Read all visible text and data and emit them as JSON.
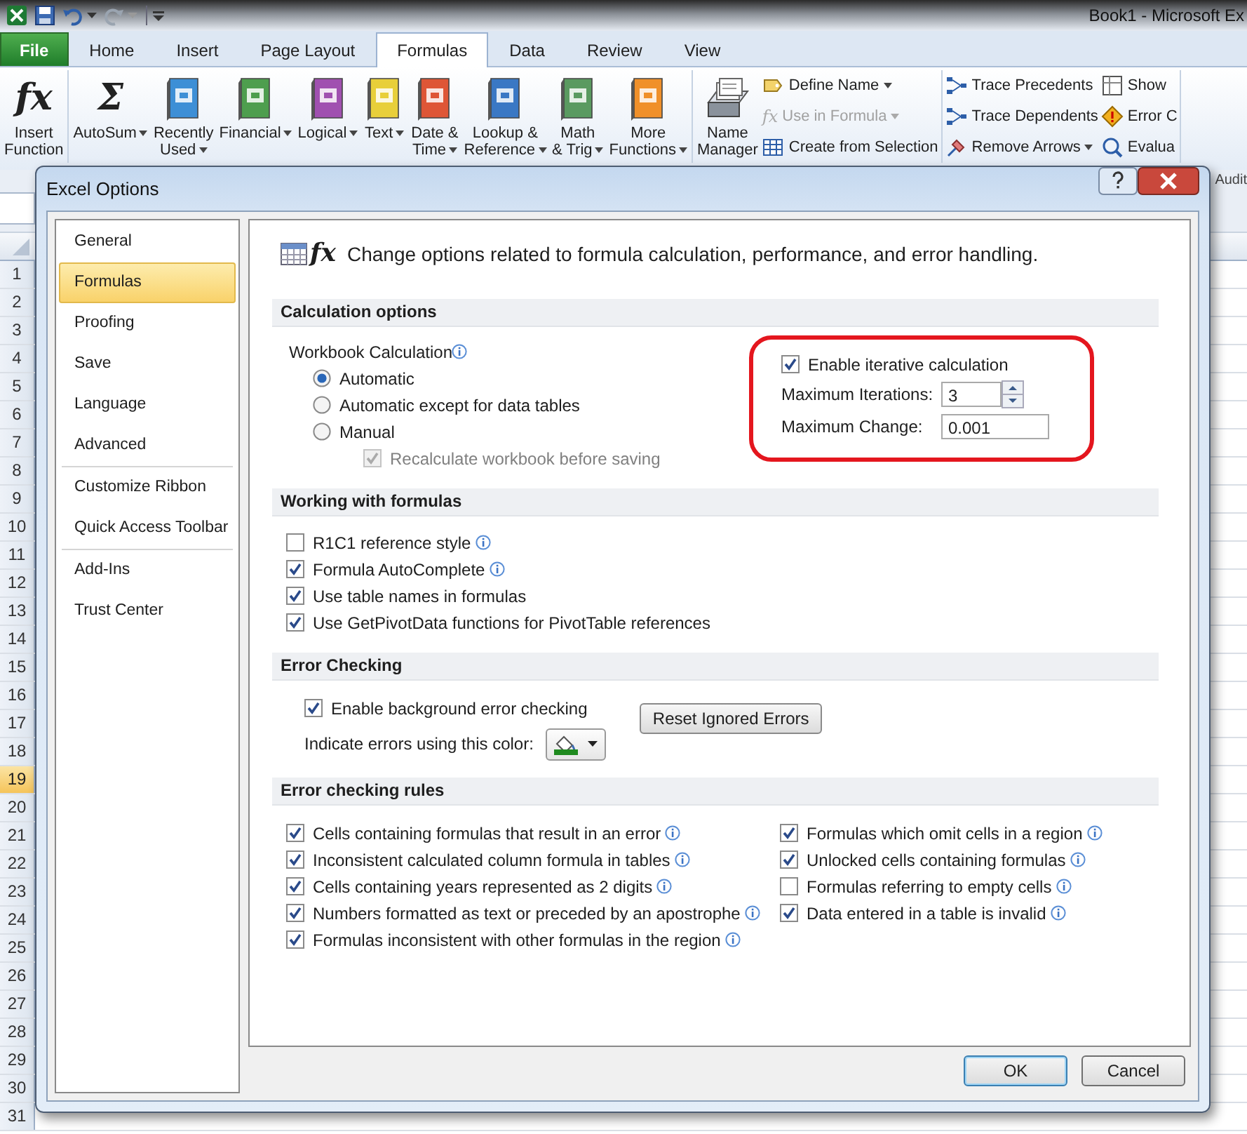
{
  "titlebar": {
    "title": "Book1 - Microsoft Ex"
  },
  "ribbon_tabs": [
    {
      "label": "File",
      "kind": "file",
      "selected": false
    },
    {
      "label": "Home",
      "kind": "tab",
      "selected": false
    },
    {
      "label": "Insert",
      "kind": "tab",
      "selected": false
    },
    {
      "label": "Page Layout",
      "kind": "tab",
      "selected": false
    },
    {
      "label": "Formulas",
      "kind": "tab",
      "selected": true
    },
    {
      "label": "Data",
      "kind": "tab",
      "selected": false
    },
    {
      "label": "Review",
      "kind": "tab",
      "selected": false
    },
    {
      "label": "View",
      "kind": "tab",
      "selected": false
    }
  ],
  "ribbon_groups": [
    {
      "large": [
        {
          "lines": [
            "Insert",
            "Function"
          ],
          "kind": "glyph",
          "glyph": "fx",
          "dropdown": false
        }
      ]
    },
    {
      "large": [
        {
          "lines": [
            "AutoSum"
          ],
          "kind": "glyph",
          "glyph": "Σ",
          "dropdown": true
        },
        {
          "lines": [
            "Recently",
            "Used"
          ],
          "kind": "book",
          "color": "#3d8fd6",
          "dropdown": true
        },
        {
          "lines": [
            "Financial"
          ],
          "kind": "book",
          "color": "#4e9e4e",
          "dropdown": true
        },
        {
          "lines": [
            "Logical"
          ],
          "kind": "book",
          "color": "#a050b0",
          "dropdown": true
        },
        {
          "lines": [
            "Text"
          ],
          "kind": "book",
          "color": "#e8cf3a",
          "dropdown": true
        },
        {
          "lines": [
            "Date &",
            "Time"
          ],
          "kind": "book",
          "color": "#de5636",
          "dropdown": true
        },
        {
          "lines": [
            "Lookup &",
            "Reference"
          ],
          "kind": "book",
          "color": "#3a78c4",
          "dropdown": true
        },
        {
          "lines": [
            "Math",
            "& Trig"
          ],
          "kind": "book",
          "color": "#5a9a60",
          "dropdown": true
        },
        {
          "lines": [
            "More",
            "Functions"
          ],
          "kind": "book",
          "color": "#f0902a",
          "dropdown": true
        }
      ]
    },
    {
      "large": [
        {
          "lines": [
            "Name",
            "Manager"
          ],
          "kind": "cards",
          "dropdown": false
        }
      ],
      "small_columns": [
        [
          {
            "label": "Define Name",
            "kind": "tag",
            "dropdown": true,
            "disabled": false
          },
          {
            "label": "Use in Formula",
            "kind": "glyph",
            "glyph": "fx",
            "dropdown": true,
            "disabled": true
          },
          {
            "label": "Create from Selection",
            "kind": "table",
            "dropdown": false,
            "disabled": false
          }
        ]
      ]
    },
    {
      "small_columns": [
        [
          {
            "label": "Trace Precedents",
            "kind": "trace",
            "dropdown": false,
            "disabled": false
          },
          {
            "label": "Trace Dependents",
            "kind": "trace",
            "dropdown": false,
            "disabled": false
          },
          {
            "label": "Remove Arrows",
            "kind": "eraser",
            "dropdown": true,
            "disabled": false
          }
        ],
        [
          {
            "label": "Show",
            "kind": "sheet",
            "dropdown": false,
            "disabled": false
          },
          {
            "label": "Error C",
            "kind": "warning",
            "dropdown": false,
            "disabled": false
          },
          {
            "label": "Evalua",
            "kind": "evaluate",
            "dropdown": false,
            "disabled": false
          }
        ]
      ]
    }
  ],
  "group_label": "Audit",
  "sheet": {
    "rows": [
      {
        "label": "1",
        "selected": false
      },
      {
        "label": "2",
        "selected": false
      },
      {
        "label": "3",
        "selected": false
      },
      {
        "label": "4",
        "selected": false
      },
      {
        "label": "5",
        "selected": false
      },
      {
        "label": "6",
        "selected": false
      },
      {
        "label": "7",
        "selected": false
      },
      {
        "label": "8",
        "selected": false
      },
      {
        "label": "9",
        "selected": false
      },
      {
        "label": "10",
        "selected": false
      },
      {
        "label": "11",
        "selected": false
      },
      {
        "label": "12",
        "selected": false
      },
      {
        "label": "13",
        "selected": false
      },
      {
        "label": "14",
        "selected": false
      },
      {
        "label": "15",
        "selected": false
      },
      {
        "label": "16",
        "selected": false
      },
      {
        "label": "17",
        "selected": false
      },
      {
        "label": "18",
        "selected": false
      },
      {
        "label": "19",
        "selected": true
      },
      {
        "label": "20",
        "selected": false
      },
      {
        "label": "21",
        "selected": false
      },
      {
        "label": "22",
        "selected": false
      },
      {
        "label": "23",
        "selected": false
      },
      {
        "label": "24",
        "selected": false
      },
      {
        "label": "25",
        "selected": false
      },
      {
        "label": "26",
        "selected": false
      },
      {
        "label": "27",
        "selected": false
      },
      {
        "label": "28",
        "selected": false
      },
      {
        "label": "29",
        "selected": false
      },
      {
        "label": "30",
        "selected": false
      },
      {
        "label": "31",
        "selected": false
      }
    ]
  },
  "dialog": {
    "title": "Excel Options",
    "nav_groups": [
      [
        {
          "label": "General",
          "selected": false
        },
        {
          "label": "Formulas",
          "selected": true
        },
        {
          "label": "Proofing",
          "selected": false
        },
        {
          "label": "Save",
          "selected": false
        },
        {
          "label": "Language",
          "selected": false
        },
        {
          "label": "Advanced",
          "selected": false
        }
      ],
      [
        {
          "label": "Customize Ribbon",
          "selected": false
        },
        {
          "label": "Quick Access Toolbar",
          "selected": false
        }
      ],
      [
        {
          "label": "Add-Ins",
          "selected": false
        },
        {
          "label": "Trust Center",
          "selected": false
        }
      ]
    ],
    "header": {
      "glyph": "fx",
      "text": "Change options related to formula calculation, performance, and error handling."
    },
    "calculation": {
      "title": "Calculation options",
      "workbook_label": "Workbook Calculation",
      "workbook_info": true,
      "modes": [
        {
          "label": "Automatic",
          "selected": true
        },
        {
          "label": "Automatic except for data tables",
          "selected": false
        },
        {
          "label": "Manual",
          "selected": false
        }
      ],
      "recalc": {
        "label": "Recalculate workbook before saving",
        "checked": true,
        "disabled": true
      },
      "iterative": {
        "label": "Enable iterative calculation",
        "checked": true
      },
      "max_iterations": {
        "label": "Maximum Iterations:",
        "value": "3"
      },
      "max_change": {
        "label": "Maximum Change:",
        "value": "0.001"
      }
    },
    "formulas": {
      "title": "Working with formulas",
      "options": [
        {
          "label": "R1C1 reference style",
          "checked": false,
          "info": true
        },
        {
          "label": "Formula AutoComplete",
          "checked": true,
          "info": true
        },
        {
          "label": "Use table names in formulas",
          "checked": true,
          "info": false
        },
        {
          "label": "Use GetPivotData functions for PivotTable references",
          "checked": true,
          "info": false
        }
      ]
    },
    "error_checking": {
      "title": "Error Checking",
      "background": {
        "label": "Enable background error checking",
        "checked": true
      },
      "color_label": "Indicate errors using this color:",
      "color": "#1f8a1f",
      "reset_button": "Reset Ignored Errors"
    },
    "rules": {
      "title": "Error checking rules",
      "columns": [
        [
          {
            "label": "Cells containing formulas that result in an error",
            "checked": true,
            "info": true
          },
          {
            "label": "Inconsistent calculated column formula in tables",
            "checked": true,
            "info": true
          },
          {
            "label": "Cells containing years represented as 2 digits",
            "checked": true,
            "info": true
          },
          {
            "label": "Numbers formatted as text or preceded by an apostrophe",
            "checked": true,
            "info": true
          },
          {
            "label": "Formulas inconsistent with other formulas in the region",
            "checked": true,
            "info": true
          }
        ],
        [
          {
            "label": "Formulas which omit cells in a region",
            "checked": true,
            "info": true
          },
          {
            "label": "Unlocked cells containing formulas",
            "checked": true,
            "info": true
          },
          {
            "label": "Formulas referring to empty cells",
            "checked": false,
            "info": true
          },
          {
            "label": "Data entered in a table is invalid",
            "checked": true,
            "info": true
          }
        ]
      ]
    },
    "buttons": [
      "OK",
      "Cancel"
    ]
  }
}
